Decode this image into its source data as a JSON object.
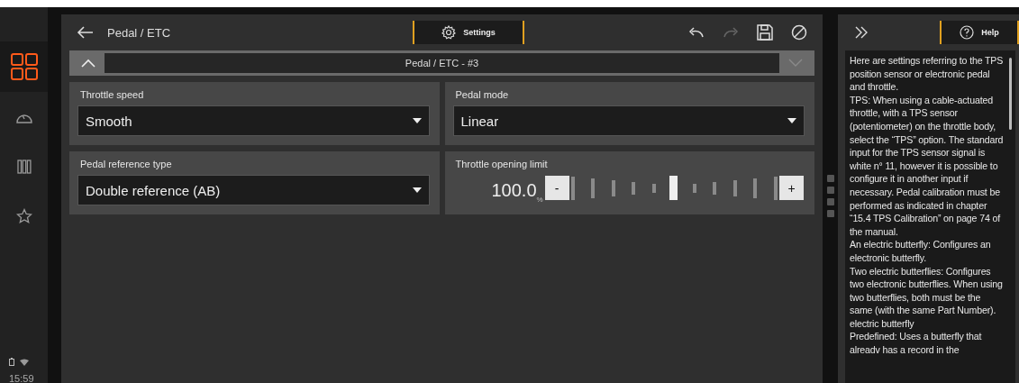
{
  "nav": {
    "items": [
      {
        "kind": "grid",
        "selected": true
      },
      {
        "kind": "gauge",
        "selected": false
      },
      {
        "kind": "bars",
        "selected": false
      },
      {
        "kind": "star",
        "selected": false
      }
    ],
    "clock": "15:59"
  },
  "header": {
    "title": "Pedal / ETC",
    "tab": "Settings",
    "redo_disabled": true
  },
  "section": {
    "title": "Pedal / ETC - #3",
    "expanded": true
  },
  "fields": [
    {
      "kind": "select",
      "label": "Throttle speed",
      "value": "Smooth"
    },
    {
      "kind": "select",
      "label": "Pedal mode",
      "value": "Linear"
    },
    {
      "kind": "select",
      "label": "Pedal reference type",
      "value": "Double reference (AB)"
    },
    {
      "kind": "jog",
      "label": "Throttle opening limit",
      "value": "100.0",
      "unit": "%",
      "minus": "-",
      "plus": "+",
      "level": 0.5
    }
  ],
  "help": {
    "tab": "Help",
    "paragraphs": [
      "Here are settings referring to the TPS position sensor or electronic pedal and throttle.",
      "TPS: When using a cable-actuated throttle, with a TPS sensor (potentiometer) on the throttle body, select the “TPS” option. The standard input for the TPS sensor signal is white n° 11, however it is possible to configure it in another input if necessary. Pedal calibration must be performed as indicated in chapter “15.4 TPS Calibration” on page 74 of the manual.",
      "An electric butterfly: Configures an electronic butterfly.",
      "Two electric butterflies: Configures two electronic butterflies. When using two butterflies, both must be the same (with the same Part Number).",
      "electric butterfly",
      "Predefined: Uses a butterfly that alreadv has a record in the"
    ]
  }
}
